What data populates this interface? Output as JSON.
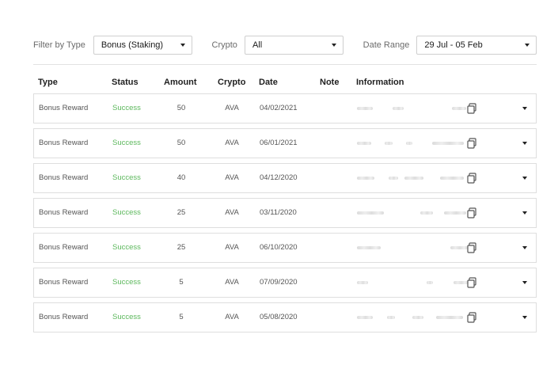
{
  "filters": {
    "type_label": "Filter by Type",
    "type_value": "Bonus (Staking)",
    "crypto_label": "Crypto",
    "crypto_value": "All",
    "date_label": "Date Range",
    "date_value": "29 Jul - 05 Feb"
  },
  "table": {
    "headers": {
      "type": "Type",
      "status": "Status",
      "amount": "Amount",
      "crypto": "Crypto",
      "date": "Date",
      "note": "Note",
      "information": "Information"
    },
    "rows": [
      {
        "type": "Bonus Reward",
        "status": "Success",
        "amount": "50",
        "crypto": "AVA",
        "date": "04/02/2021"
      },
      {
        "type": "Bonus Reward",
        "status": "Success",
        "amount": "50",
        "crypto": "AVA",
        "date": "06/01/2021"
      },
      {
        "type": "Bonus Reward",
        "status": "Success",
        "amount": "40",
        "crypto": "AVA",
        "date": "04/12/2020"
      },
      {
        "type": "Bonus Reward",
        "status": "Success",
        "amount": "25",
        "crypto": "AVA",
        "date": "03/11/2020"
      },
      {
        "type": "Bonus Reward",
        "status": "Success",
        "amount": "25",
        "crypto": "AVA",
        "date": "06/10/2020"
      },
      {
        "type": "Bonus Reward",
        "status": "Success",
        "amount": "5",
        "crypto": "AVA",
        "date": "07/09/2020"
      },
      {
        "type": "Bonus Reward",
        "status": "Success",
        "amount": "5",
        "crypto": "AVA",
        "date": "05/08/2020"
      }
    ]
  },
  "colors": {
    "success": "#5cb85c",
    "border": "#dedede"
  },
  "icons": {
    "copy": "copy-icon",
    "expand": "chevron-down-icon",
    "dropdown": "caret-down-icon"
  }
}
